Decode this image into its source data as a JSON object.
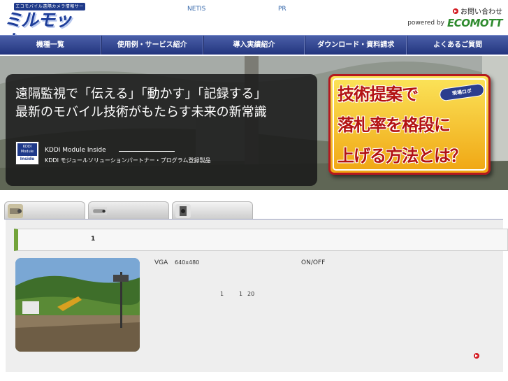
{
  "header": {
    "logo_tagline": "エコモバイル遠隔カメラ情報サービス",
    "logo_name": "ミルモット",
    "netis": "NETIS",
    "pr": "PR",
    "contact": "お問い合わせ",
    "powered_by": "powered by",
    "brand": "ECOMOTT"
  },
  "nav": {
    "items": [
      "機種一覧",
      "使用例・サービス紹介",
      "導入実績紹介",
      "ダウンロード・資料請求",
      "よくあるご質問"
    ]
  },
  "hero": {
    "line1": "遠隔監視で「伝える」「動かす」「記録する」",
    "line2": "最新のモバイル技術がもたらす未来の新常識",
    "badge_top": "KDDI Module",
    "badge_inside": "Inside",
    "kddi_title": "KDDI Module Inside",
    "kddi_sub": "KDDI モジュールソリューションパートナー・プログラム登録製品",
    "promo_line1": "技術提案で",
    "promo_line2": "落札率を格段に",
    "promo_line3": "上げる方法とは？",
    "promo_stamp": "現場ロボ"
  },
  "tabs": [
    "",
    "",
    ""
  ],
  "content": {
    "title": "1",
    "vga": "VGA",
    "resolution": "640x480",
    "onoff": "ON/OFF",
    "n1": "1",
    "n2": "1",
    "n3": "20"
  },
  "colors": {
    "nav": "#2f418a",
    "accent_green": "#72a33a",
    "red": "#d31920"
  }
}
